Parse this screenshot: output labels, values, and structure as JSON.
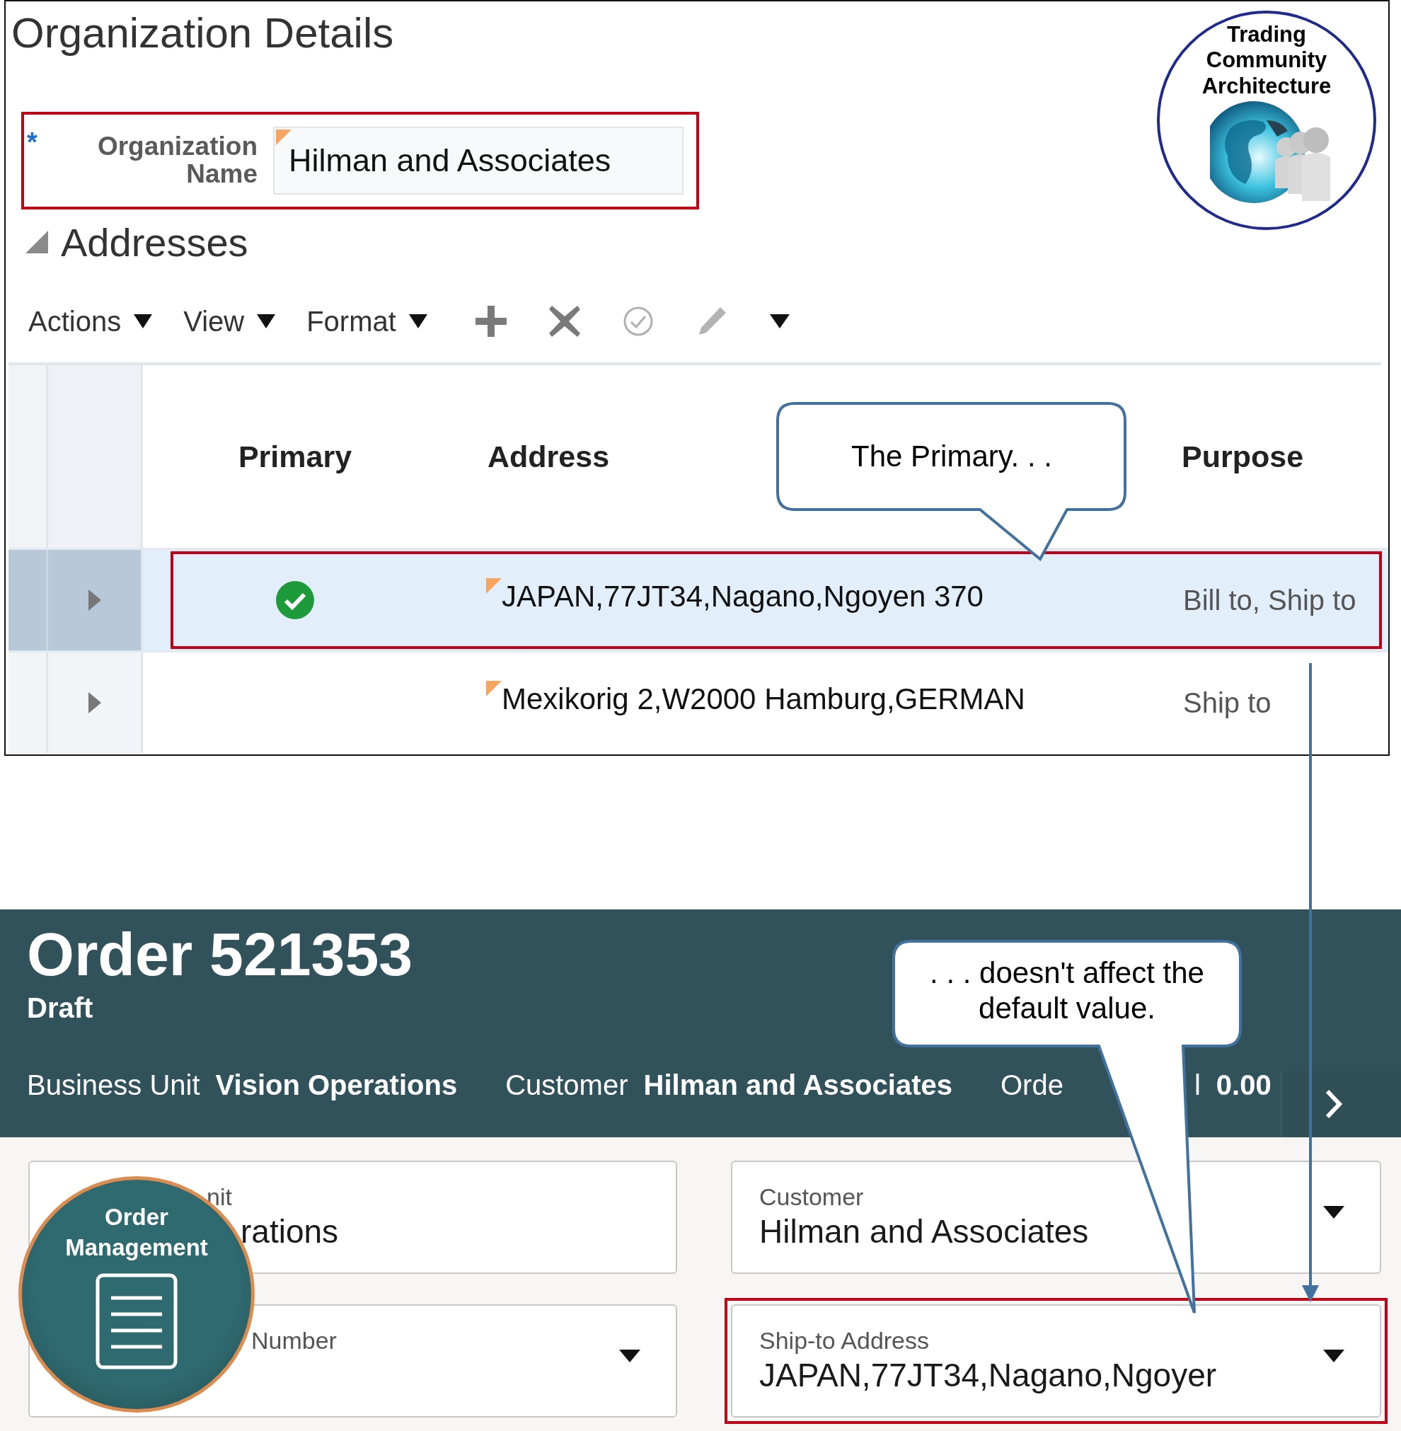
{
  "org_details": {
    "title": "Organization Details",
    "org_name": {
      "label": "Organization Name",
      "required_mark": "*",
      "value": "Hilman and Associates",
      "highlighted": true
    },
    "tca_badge": {
      "label": "Trading Community Architecture"
    },
    "addresses": {
      "title": "Addresses",
      "expanded": true,
      "menus": [
        "Actions",
        "View",
        "Format"
      ],
      "columns": [
        "Primary",
        "Address",
        "Purpose"
      ],
      "rows": [
        {
          "primary": true,
          "address": "JAPAN,77JT34,Nagano,Ngoyen 370",
          "purpose": "Bill to, Ship to",
          "selected": true,
          "highlighted": true
        },
        {
          "primary": false,
          "address": "Mexikorig 2,W2000 Hamburg,GERMAN",
          "purpose": "Ship to",
          "selected": false,
          "highlighted": false
        }
      ]
    }
  },
  "order": {
    "title": "Order 521353",
    "status": "Draft",
    "info": [
      {
        "label": [
          "Business Unit"
        ],
        "value": "Vision Operations"
      },
      {
        "label": [
          "Customer"
        ],
        "value": "Hilman and Associates"
      },
      {
        "label": [
          "Orde",
          "l"
        ],
        "value": "0.00"
      }
    ],
    "fields": [
      {
        "label": "nit",
        "value": "rations",
        "dropdown": false,
        "highlighted": false
      },
      {
        "label": "Number",
        "dropdown": true,
        "highlighted": false
      },
      {
        "label": "Customer",
        "value": "Hilman and Associates",
        "dropdown": true,
        "highlighted": false
      },
      {
        "label": "Ship-to Address",
        "value": "JAPAN,77JT34,Nagano,Ngoyer",
        "dropdown": true,
        "highlighted": true
      }
    ],
    "om_badge": {
      "label": "Order Management"
    }
  },
  "callouts": [
    {
      "text": "The Primary. . ."
    },
    {
      "text": ". . . doesn't affect the default value."
    }
  ]
}
